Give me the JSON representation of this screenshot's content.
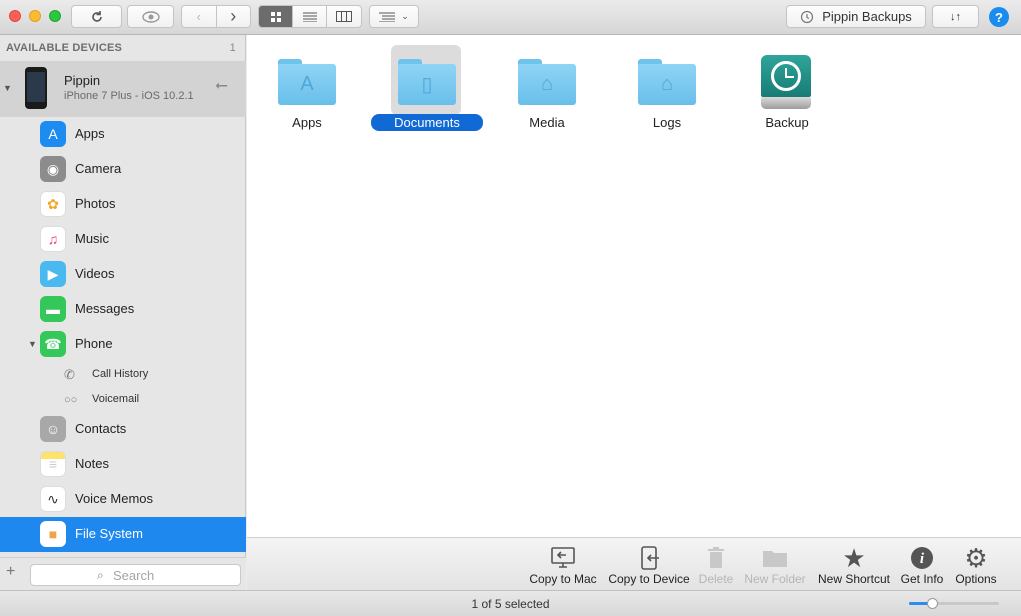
{
  "window": {
    "title": "Pippin Backups"
  },
  "toolbar": {
    "refresh_icon": "refresh-icon",
    "preview_icon": "eye-icon",
    "back_icon": "chevron-left-icon",
    "forward_icon": "chevron-right-icon",
    "views": [
      "icon-view",
      "list-view",
      "column-view"
    ],
    "active_view": "icon-view",
    "sort_icon": "sort-menu-icon",
    "backups_label": "Pippin Backups",
    "transfer_icon": "transfer-arrows-icon",
    "help_label": "?"
  },
  "sidebar": {
    "header": "AVAILABLE DEVICES",
    "device_count": "1",
    "device": {
      "name": "Pippin",
      "subtitle": "iPhone 7 Plus - iOS 10.2.1"
    },
    "items": [
      {
        "label": "Apps",
        "icon": "app-store-icon",
        "color": "#1d8cf0"
      },
      {
        "label": "Camera",
        "icon": "camera-icon",
        "color": "#8c8c8c"
      },
      {
        "label": "Photos",
        "icon": "photos-icon",
        "color": "#f5a623"
      },
      {
        "label": "Music",
        "icon": "music-icon",
        "color": "#ffffff"
      },
      {
        "label": "Videos",
        "icon": "videos-icon",
        "color": "#49b9f0"
      },
      {
        "label": "Messages",
        "icon": "messages-icon",
        "color": "#34c759"
      },
      {
        "label": "Phone",
        "icon": "phone-icon",
        "color": "#34c759"
      },
      {
        "label": "Contacts",
        "icon": "contacts-icon",
        "color": "#a8a8a8"
      },
      {
        "label": "Notes",
        "icon": "notes-icon",
        "color": "#fde36b"
      },
      {
        "label": "Voice Memos",
        "icon": "voice-memos-icon",
        "color": "#ffffff"
      },
      {
        "label": "File System",
        "icon": "file-system-icon",
        "color": "#f0a34c"
      }
    ],
    "phone_subitems": [
      {
        "label": "Call History",
        "icon": "phone-outline-icon"
      },
      {
        "label": "Voicemail",
        "icon": "voicemail-icon"
      }
    ],
    "selected": "File System",
    "search_placeholder": "Search"
  },
  "main": {
    "items": [
      {
        "name": "Apps",
        "icon": "folder-apps-icon",
        "selected": false
      },
      {
        "name": "Documents",
        "icon": "folder-documents-icon",
        "selected": true
      },
      {
        "name": "Media",
        "icon": "folder-media-icon",
        "selected": false
      },
      {
        "name": "Logs",
        "icon": "folder-logs-icon",
        "selected": false
      },
      {
        "name": "Backup",
        "icon": "time-machine-disk-icon",
        "selected": false
      }
    ]
  },
  "actions": [
    {
      "label": "Copy to Mac",
      "icon": "copy-to-mac-icon",
      "enabled": true
    },
    {
      "label": "Copy to Device",
      "icon": "copy-to-device-icon",
      "enabled": true
    },
    {
      "label": "Delete",
      "icon": "trash-icon",
      "enabled": false
    },
    {
      "label": "New Folder",
      "icon": "new-folder-icon",
      "enabled": false
    },
    {
      "label": "New Shortcut",
      "icon": "star-icon",
      "enabled": true
    },
    {
      "label": "Get Info",
      "icon": "info-icon",
      "enabled": true
    },
    {
      "label": "Options",
      "icon": "gear-icon",
      "enabled": true
    }
  ],
  "status": {
    "text": "1 of 5 selected",
    "zoom_fraction": 0.25
  }
}
